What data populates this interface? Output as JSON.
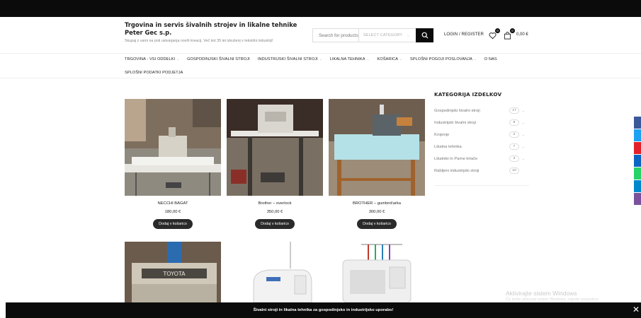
{
  "brand": {
    "title": "Trgovina in servis šivalnih strojev in likalne tehnike Peter Gec s.p.",
    "subtitle": "Skupaj z vami na poti ustvarjanja novih kreacij. Več kot 35 let izkušenj v tekstilni industriji!"
  },
  "search": {
    "placeholder": "Search for products",
    "category": "SELECT CATEGORY"
  },
  "header": {
    "login": "LOGIN / REGISTER",
    "wishlist_count": "0",
    "cart_count": "0",
    "cart_total": "0,00 €"
  },
  "nav": {
    "row1": [
      {
        "label": "TRGOVINA - VSI ODDELKI"
      },
      {
        "label": "GOSPODINJSKI ŠIVALNI STROJI"
      },
      {
        "label": "INDUSTRIJSKI ŠIVALNI STROJI"
      },
      {
        "label": "LIKALNA TEHNIKA"
      },
      {
        "label": "KOŠARICA"
      },
      {
        "label": "SPLOŠNI POGOJI POSLOVANJA"
      },
      {
        "label": "O NAS"
      }
    ],
    "row2": [
      {
        "label": "SPLOŠNI PODATKI PODJETJA"
      }
    ]
  },
  "products": [
    {
      "name": "NECCHI BAGAT",
      "price": "180,00 €",
      "button": "Dodaj v košarico"
    },
    {
      "name": "Brother – overlock",
      "price": "350,00 €",
      "button": "Dodaj v košarico"
    },
    {
      "name": "BROTHER – gumbničarka",
      "price": "300,00 €",
      "button": "Dodaj v košarico"
    }
  ],
  "sidebar": {
    "title": "KATEGORIJA IZDELKOV",
    "categories": [
      {
        "label": "Gospodinjski šivalni stroji",
        "count": "17"
      },
      {
        "label": "Industrijski šivalni stroji",
        "count": "8"
      },
      {
        "label": "Krojenje",
        "count": "2"
      },
      {
        "label": "Likalna tehnika",
        "count": "7"
      },
      {
        "label": "Likalniki in Parne krtače",
        "count": "3"
      },
      {
        "label": "Rabljeni industrijski stroji",
        "count": "10"
      }
    ]
  },
  "row2_labels": {
    "machine": "TOYOTA"
  },
  "windows": {
    "title": "Aktivirajte sistem Windows",
    "subtitle": "Če želite aktivirati sistem Windows, odprite nastavitve."
  },
  "bottombar": {
    "text": "Šivalni stroji in likalna tehnika za gospodinjsko in industrijsko uporabo!"
  },
  "colors": {
    "dark": "#0b0b0b",
    "button": "#2a2a2a",
    "social": [
      "#3b5998",
      "#1da1f2",
      "#e4202a",
      "#0a66c2",
      "#25d366",
      "#0088cc",
      "#7b519d"
    ]
  }
}
